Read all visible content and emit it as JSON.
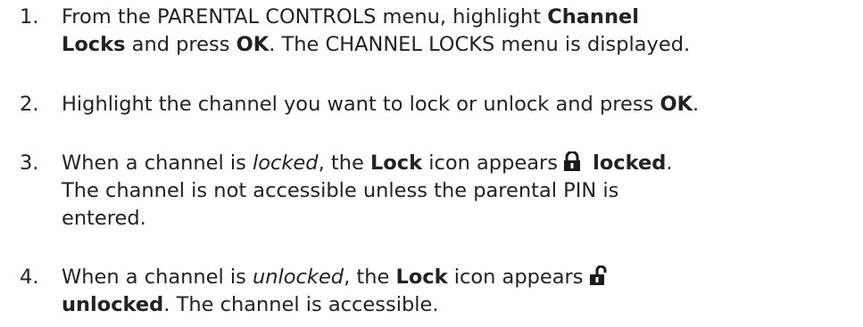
{
  "steps": [
    {
      "number": "1.",
      "line1_a": "From the PARENTAL CONTROLS menu, highlight ",
      "line1_b": "Channel",
      "line2_a": "Locks",
      "line2_b": " and press ",
      "line2_c": "OK",
      "line2_d": ". The CHANNEL LOCKS menu is displayed."
    },
    {
      "number": "2.",
      "line1_a": "Highlight the channel you want to lock or unlock and press ",
      "line1_b": "OK",
      "line1_c": "."
    },
    {
      "number": "3.",
      "line1_a": "When a channel is ",
      "line1_b": "locked",
      "line1_c": ", the ",
      "line1_d": "Lock",
      "line1_e": " icon appears",
      "icon": "lock-closed-icon",
      "line1_f": "locked",
      "line1_g": ".",
      "line2": "The channel is not accessible unless the parental PIN is",
      "line3": "entered."
    },
    {
      "number": "4.",
      "line1_a": "When a channel is ",
      "line1_b": "unlocked",
      "line1_c": ", the ",
      "line1_d": "Lock",
      "line1_e": " icon appears",
      "icon": "lock-open-icon",
      "line2_a": "unlocked",
      "line2_b": ". The channel is accessible."
    }
  ]
}
